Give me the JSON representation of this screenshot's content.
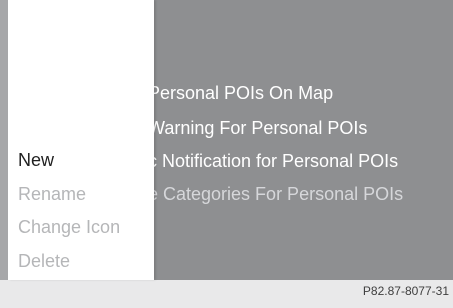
{
  "background_menu": {
    "items": [
      {
        "label": "Personal POIs On Map"
      },
      {
        "label": "Warning For Personal POIs"
      },
      {
        "label": "c Notification for Personal POIs"
      },
      {
        "label": "e Categories For Personal POIs"
      }
    ]
  },
  "submenu": {
    "items": [
      {
        "label": "New",
        "state": "enabled"
      },
      {
        "label": "Rename",
        "state": "disabled"
      },
      {
        "label": "Change Icon",
        "state": "disabled"
      },
      {
        "label": "Delete",
        "state": "disabled"
      }
    ]
  },
  "caption": "P82.87-8077-31",
  "colors": {
    "screen_background": "#8e8f91",
    "submenu_background": "#ffffff",
    "enabled_text": "#1f1f1f",
    "disabled_text": "#b5b6b8"
  }
}
